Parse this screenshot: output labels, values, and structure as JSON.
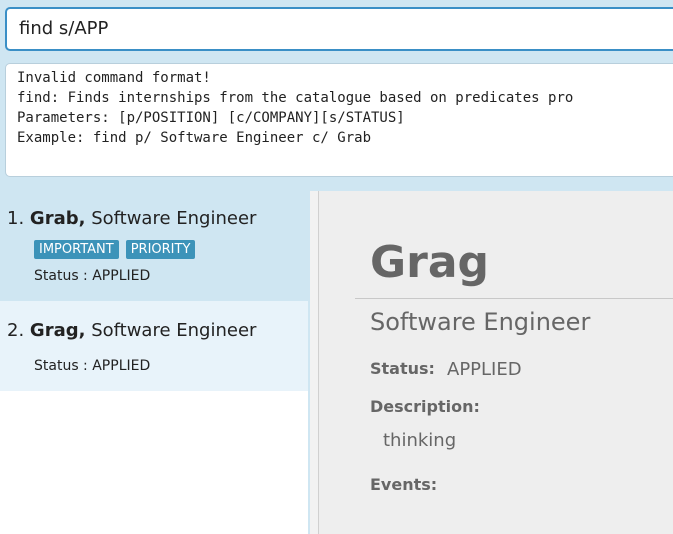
{
  "command_box": {
    "value": "find s/APP"
  },
  "result_display": {
    "lines": [
      "Invalid command format!",
      "find: Finds internships from the catalogue based on predicates pro",
      "Parameters: [p/POSITION] [c/COMPANY][s/STATUS]",
      "Example: find p/ Software Engineer c/ Grab"
    ]
  },
  "internship_list": [
    {
      "index": "1.",
      "company": "Grab,",
      "position": "Software Engineer",
      "tags": [
        "IMPORTANT",
        "PRIORITY"
      ],
      "status": "Status : APPLIED"
    },
    {
      "index": "2.",
      "company": "Grag,",
      "position": "Software Engineer",
      "tags": [],
      "status": "Status : APPLIED"
    }
  ],
  "detail": {
    "company": "Grag",
    "position": "Software Engineer",
    "status_label": "Status:",
    "status_value": "APPLIED",
    "description_label": "Description:",
    "description_value": "thinking",
    "events_label": "Events:"
  },
  "colors": {
    "accent": "#3a8fc6",
    "tag": "#3c93b9",
    "selected_card": "#cfe6f2"
  }
}
